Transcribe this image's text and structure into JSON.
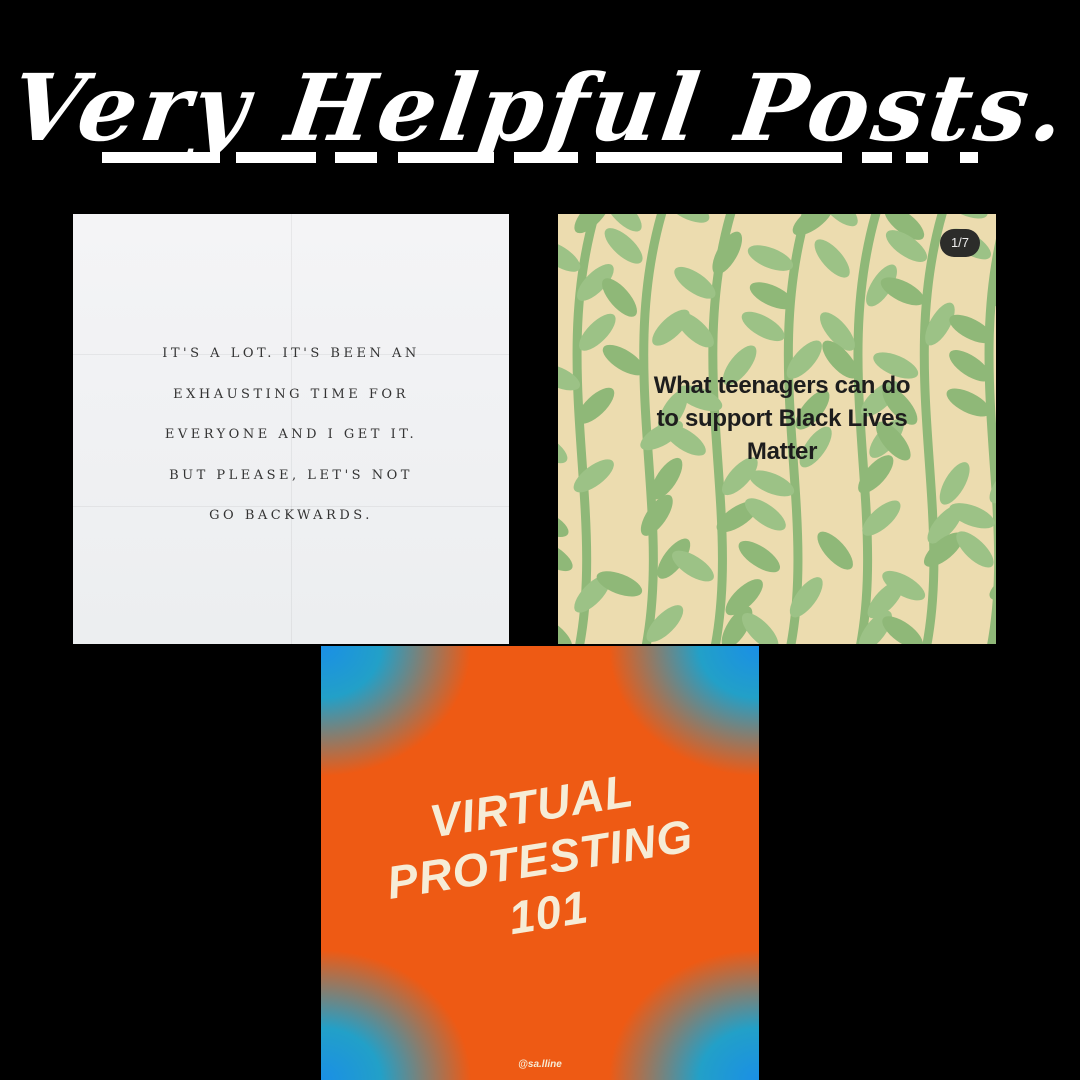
{
  "title": "Very Helpful Posts.",
  "posts": [
    {
      "lines": [
        "IT'S A LOT. IT'S BEEN AN",
        "EXHAUSTING TIME FOR",
        "EVERYONE AND I GET IT.",
        "BUT PLEASE, LET'S NOT",
        "GO BACKWARDS."
      ]
    },
    {
      "lines": [
        "What teenagers can do",
        "to support Black Lives",
        "Matter"
      ],
      "badge": "1/7",
      "leaf_color": "#8fb878",
      "bg_color": "#ecdcaf"
    },
    {
      "lines": [
        "VIRTUAL",
        "PROTESTING",
        "101"
      ],
      "handle": "@sa.lline"
    }
  ]
}
